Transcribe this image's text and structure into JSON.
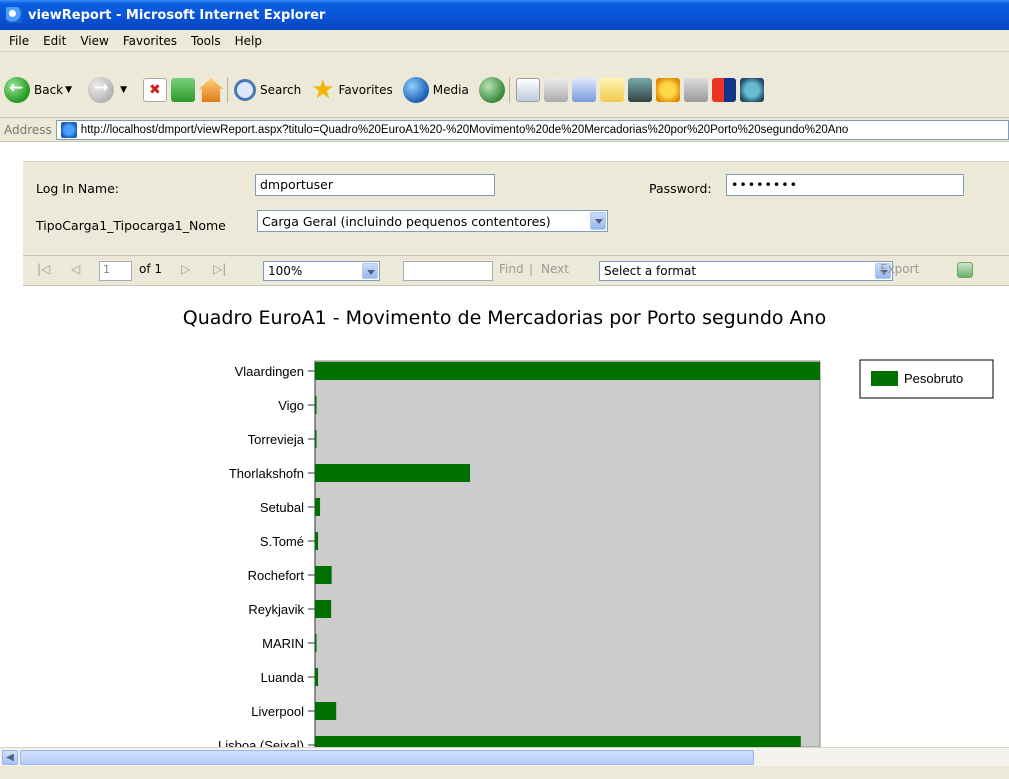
{
  "window": {
    "title": "viewReport - Microsoft Internet Explorer"
  },
  "menu": [
    "File",
    "Edit",
    "View",
    "Favorites",
    "Tools",
    "Help"
  ],
  "toolbar": {
    "back": "Back",
    "search": "Search",
    "favorites": "Favorites",
    "media": "Media"
  },
  "address": {
    "label": "Address",
    "url": "http://localhost/dmport/viewReport.aspx?titulo=Quadro%20EuroA1%20-%20Movimento%20de%20Mercadorias%20por%20Porto%20segundo%20Ano"
  },
  "params": {
    "login_label": "Log In Name:",
    "login_value": "dmportuser",
    "password_label": "Password:",
    "password_value": "••••••••",
    "tipo_label": "TipoCarga1_Tipocarga1_Nome",
    "tipo_value": "Carga Geral (incluindo pequenos contentores)"
  },
  "report_toolbar": {
    "first": "|◁",
    "prev": "◁",
    "page": "1",
    "of": "of 1",
    "next": "▷",
    "last": "▷|",
    "zoom": "100%",
    "find": "Find",
    "sep": "|",
    "next_label": "Next",
    "format": "Select a format",
    "export": "Export"
  },
  "colors": {
    "bar": "#007000",
    "plot_bg": "#cccccc"
  },
  "chart_data": {
    "type": "bar",
    "orientation": "horizontal",
    "title": "Quadro EuroA1 - Movimento de Mercadorias por Porto segundo Ano",
    "categories": [
      "Vlaardingen",
      "Vigo",
      "Torrevieja",
      "Thorlakshofn",
      "Setubal",
      "S.Tomé",
      "Rochefort",
      "Reykjavik",
      "MARIN",
      "Luanda",
      "Liverpool",
      "Lisboa (Seixal)"
    ],
    "series": [
      {
        "name": "Pesobruto",
        "values": [
          100,
          0.3,
          0.3,
          30.7,
          1,
          0.6,
          3.3,
          3.2,
          0.3,
          0.6,
          4.2,
          96.2
        ]
      }
    ],
    "xlim": [
      0,
      100
    ],
    "legend": "right"
  }
}
